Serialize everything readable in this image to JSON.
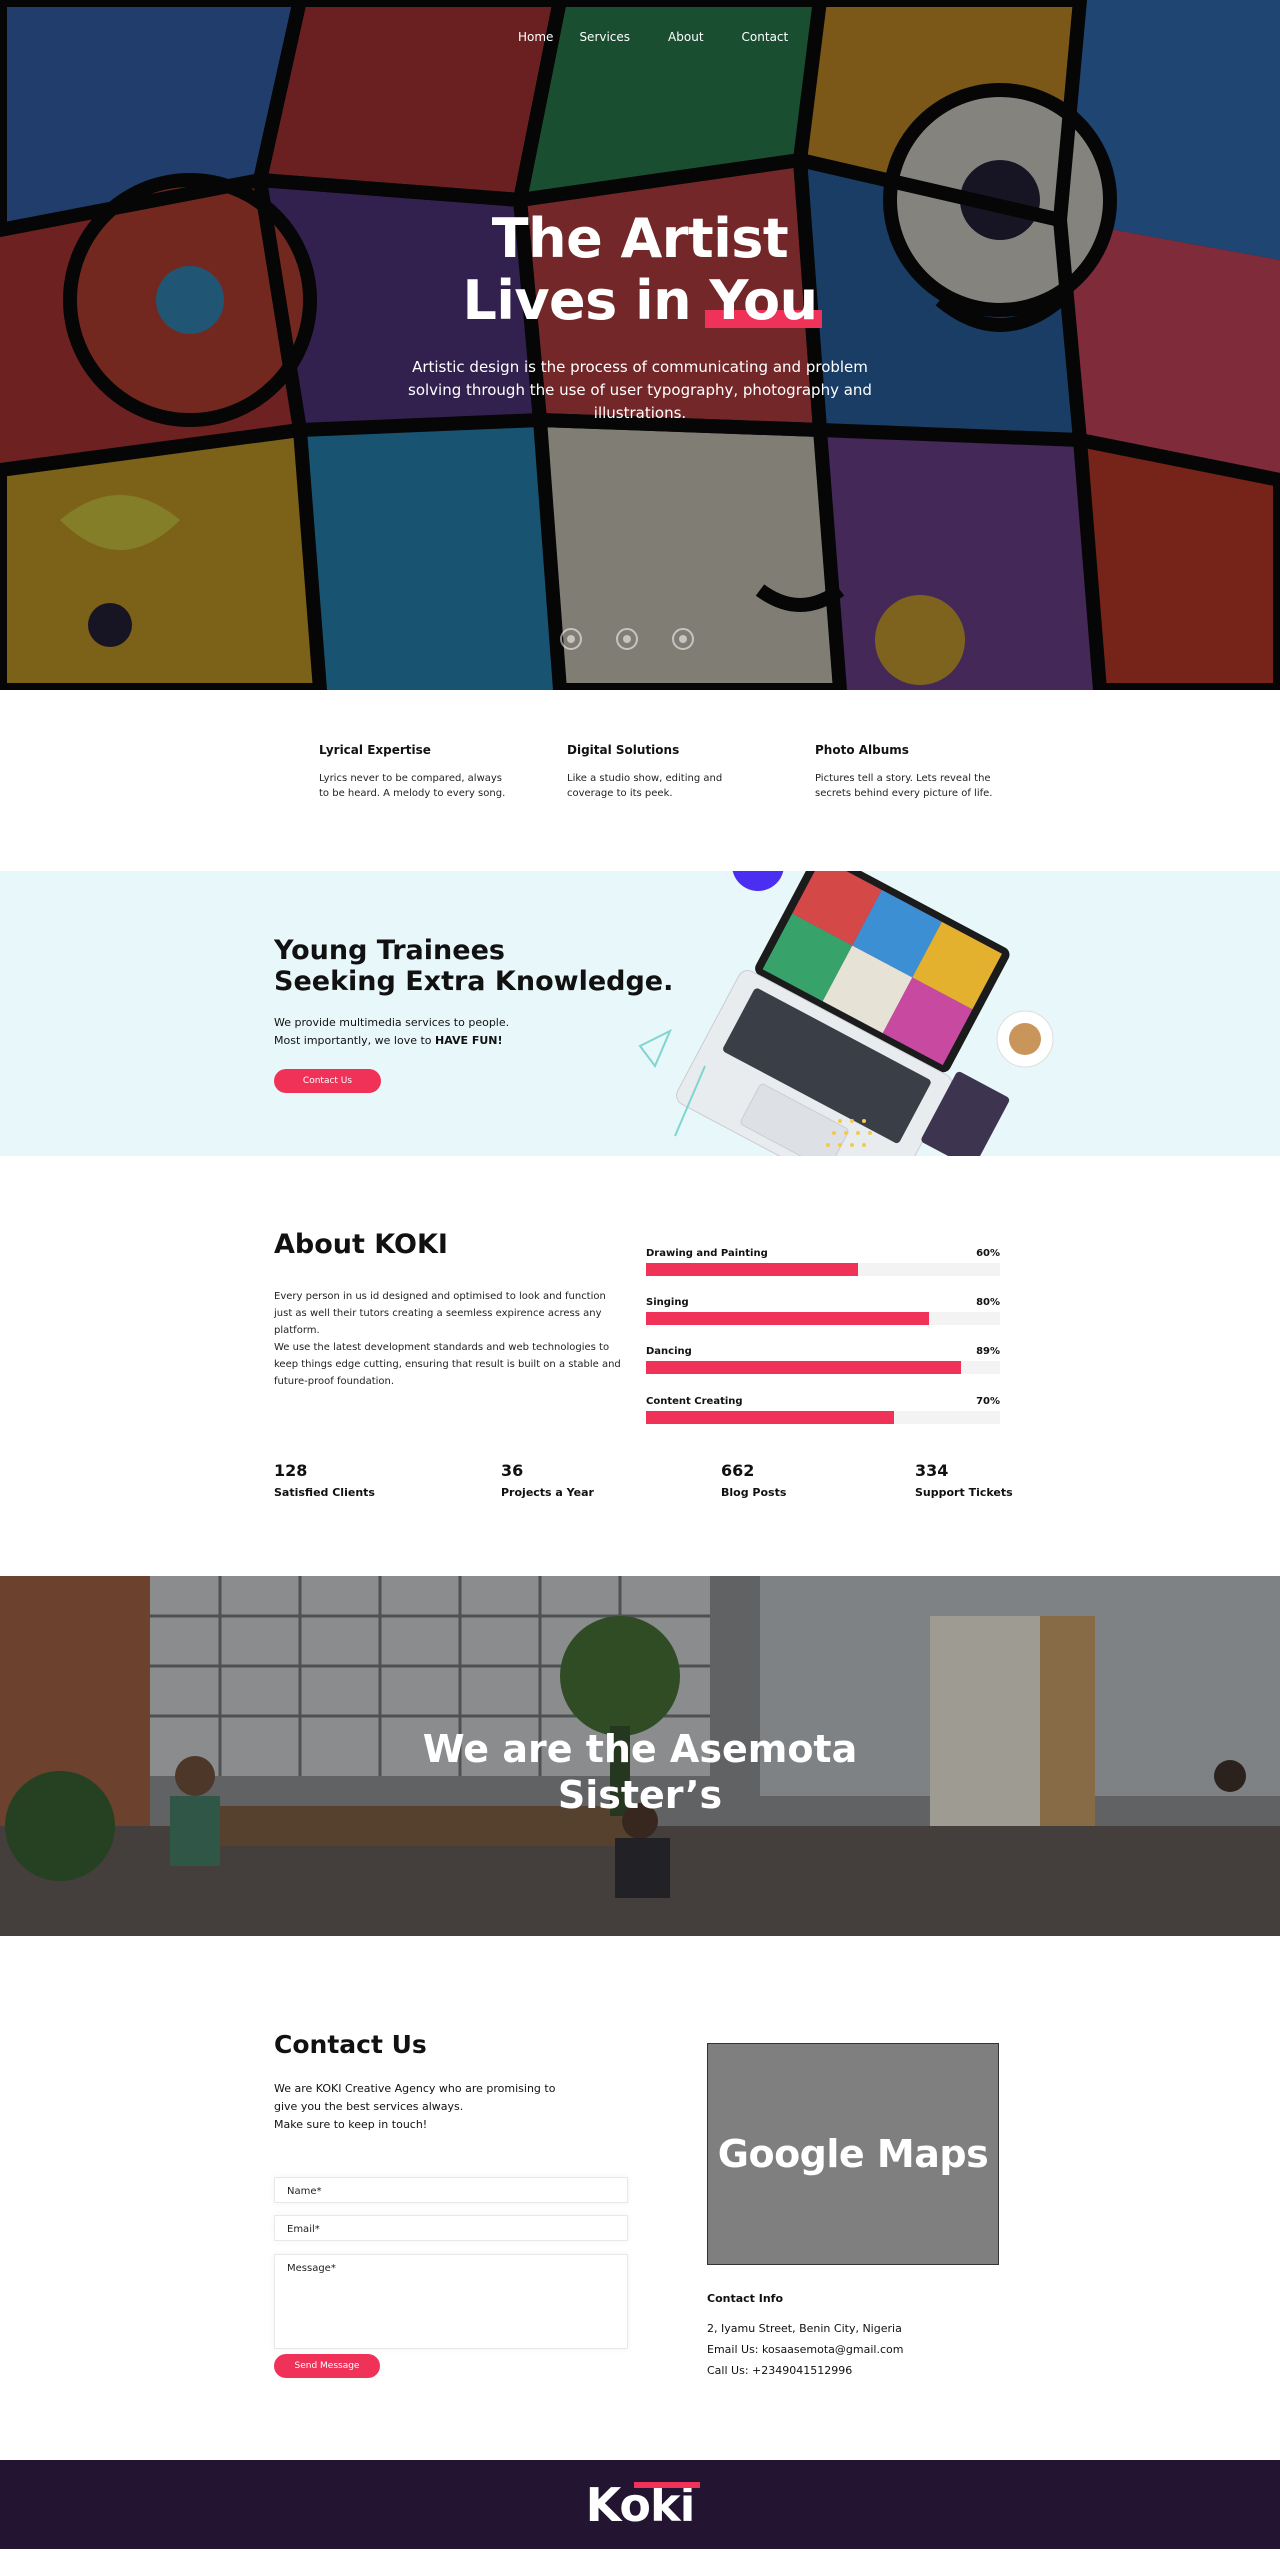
{
  "nav": {
    "items": [
      "Home",
      "Services",
      "About",
      "Contact"
    ]
  },
  "hero": {
    "title_line1": "The Artist",
    "title_line2_prefix": "Lives in ",
    "title_highlight": "You",
    "subtitle": "Artistic design is the process of communicating and problem solving through the use of user typography, photography and illustrations.",
    "slides": 3
  },
  "features": [
    {
      "title": "Lyrical Expertise",
      "text": "Lyrics never to be compared, always to be heard. A melody to every song."
    },
    {
      "title": "Digital Solutions",
      "text": "Like a studio show, editing and coverage to its peek."
    },
    {
      "title": "Photo Albums",
      "text": "Pictures tell a story. Lets reveal the secrets behind every picture of life."
    }
  ],
  "trainees": {
    "title_line1": "Young Trainees",
    "title_line2": "Seeking Extra Knowledge.",
    "text_line1": "We provide multimedia services to people.",
    "text_line2_prefix": "Most importantly, we love to ",
    "text_line2_bold": "HAVE FUN!",
    "button": "Contact Us"
  },
  "about": {
    "title": "About KOKI",
    "text1": "Every person in us id designed and optimised to look and function just as well their tutors creating a seemless expirence acress any platform.",
    "text2": "We use the latest development standards and web technologies to keep things edge cutting, ensuring that result is built on a stable and future-proof foundation.",
    "skills": [
      {
        "name": "Drawing and Painting",
        "percent": "60%",
        "value": 60
      },
      {
        "name": "Singing",
        "percent": "80%",
        "value": 80
      },
      {
        "name": "Dancing",
        "percent": "89%",
        "value": 89
      },
      {
        "name": "Content Creating",
        "percent": "70%",
        "value": 70
      }
    ],
    "stats": [
      {
        "num": "128",
        "label": "Satisfied Clients"
      },
      {
        "num": "36",
        "label": "Projects a Year"
      },
      {
        "num": "662",
        "label": "Blog Posts"
      },
      {
        "num": "334",
        "label": "Support Tickets"
      }
    ]
  },
  "team": {
    "title_line1": "We are the Asemota",
    "title_line2": "Sister’s"
  },
  "contact": {
    "title": "Contact Us",
    "intro_line1": "We are KOKI Creative Agency who are promising to",
    "intro_line2": "give you the best services always.",
    "intro_line3": "Make sure to keep in touch!",
    "name_placeholder": "Name*",
    "email_placeholder": "Email*",
    "message_placeholder": "Message*",
    "button": "Send Message",
    "map_label": "Google Maps",
    "info_title": "Contact Info",
    "address": "2, Iyamu Street, Benin City, Nigeria",
    "email": "Email Us: kosaasemota@gmail.com",
    "phone": "Call Us: +2349041512996"
  },
  "footer": {
    "logo": "Koki"
  },
  "colors": {
    "accent": "#f03259",
    "footer_bg": "#231531",
    "trainees_bg": "#e8f7f9",
    "map_bg": "#7f7f7f"
  }
}
